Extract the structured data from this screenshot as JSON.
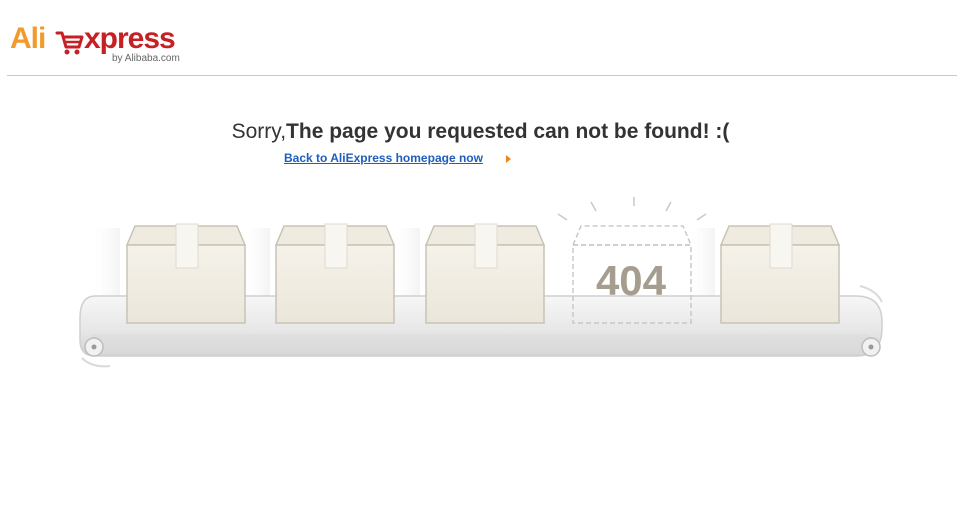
{
  "header": {
    "logo": {
      "ali": "Ali",
      "xpress": "xpress",
      "byline": "by Alibaba.com",
      "icon": "cart-icon",
      "colors": {
        "ali": "#f29a2e",
        "xpress": "#c61f24"
      }
    }
  },
  "error": {
    "message_prefix": "Sorry,",
    "message_main": "The page you requested can not be found! :(",
    "back_link": "Back to AliExpress homepage now",
    "back_arrow_icon": "arrow-right-icon",
    "code": "404"
  },
  "colors": {
    "link": "#1d5ebe",
    "arrow": "#f1831f",
    "box_fill": "#f3efe6",
    "box_stroke": "#c9c3b4",
    "code_text": "#a59e8e"
  }
}
